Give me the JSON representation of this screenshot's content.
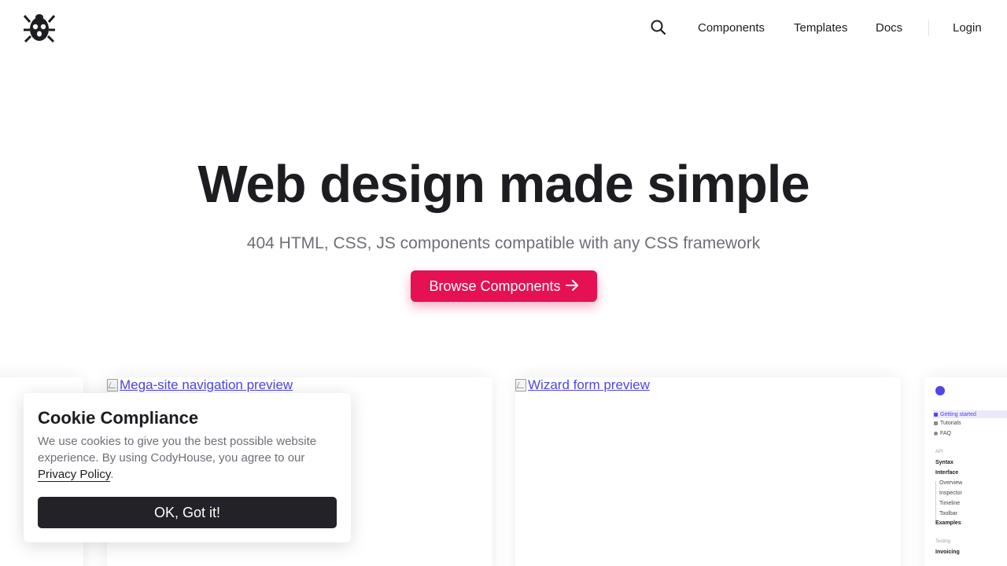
{
  "header": {
    "logo_icon": "codyhouse-bug-logo-icon",
    "search_icon": "search-icon",
    "nav": {
      "components": "Components",
      "templates": "Templates",
      "docs": "Docs",
      "login": "Login"
    }
  },
  "hero": {
    "title": "Web design made simple",
    "subtitle": "404 HTML, CSS, JS components compatible with any CSS framework",
    "cta_label": "Browse Components",
    "cta_icon": "arrow-right-icon"
  },
  "previews": {
    "mega_alt": "Mega-site navigation preview",
    "wizard_alt": "Wizard form preview",
    "docs": {
      "items": [
        "Getting started",
        "Tutorials",
        "FAQ"
      ],
      "api_heading": "API",
      "syntax": "Syntax",
      "interface": "Interface",
      "interface_items": [
        "Overview",
        "Inspector",
        "Timeline",
        "Toolbar"
      ],
      "examples": "Examples",
      "testing_heading": "Testing",
      "invoicing": "Invoicing"
    }
  },
  "cookie": {
    "title": "Cookie Compliance",
    "text_before": "We use cookies to give you the best possible website experience. By using CodyHouse, you agree to our ",
    "link": "Privacy Policy",
    "text_after": ".",
    "button": "OK, Got it!"
  },
  "colors": {
    "accent": "#e51152",
    "link": "#4f46e5",
    "dark_button": "#222228"
  }
}
